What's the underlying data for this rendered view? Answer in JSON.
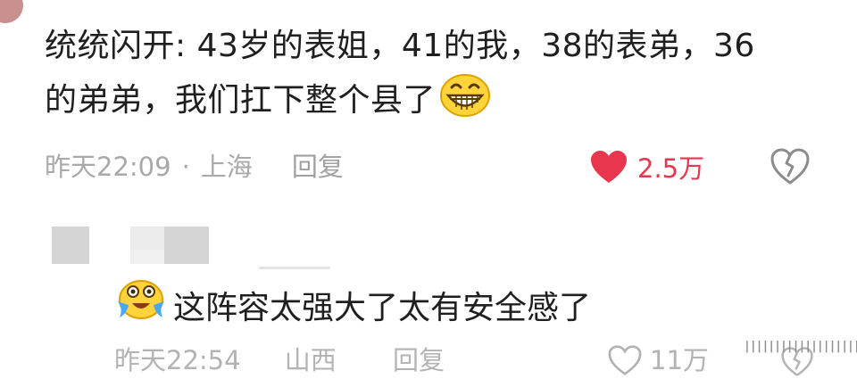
{
  "comment": {
    "text_line1": "统统闪开: 43岁的表姐，41的我，38的表弟，36",
    "text_line2": "的弟弟，我们扛下整个县了",
    "emoji": "grinning-face-emoji",
    "time": "昨天22:09",
    "dot": "·",
    "location": "上海",
    "reply_label": "回复",
    "like_count": "2.5万",
    "like_color": "#e8364e",
    "liked": true
  },
  "reply": {
    "emoji": "laughing-crying-emoji",
    "text": "这阵容太强大了太有安全感了",
    "time": "昨天22:54",
    "location": "山西",
    "reply_label": "回复",
    "like_count": "11万"
  },
  "watermark": "|||||||||||||||||||"
}
